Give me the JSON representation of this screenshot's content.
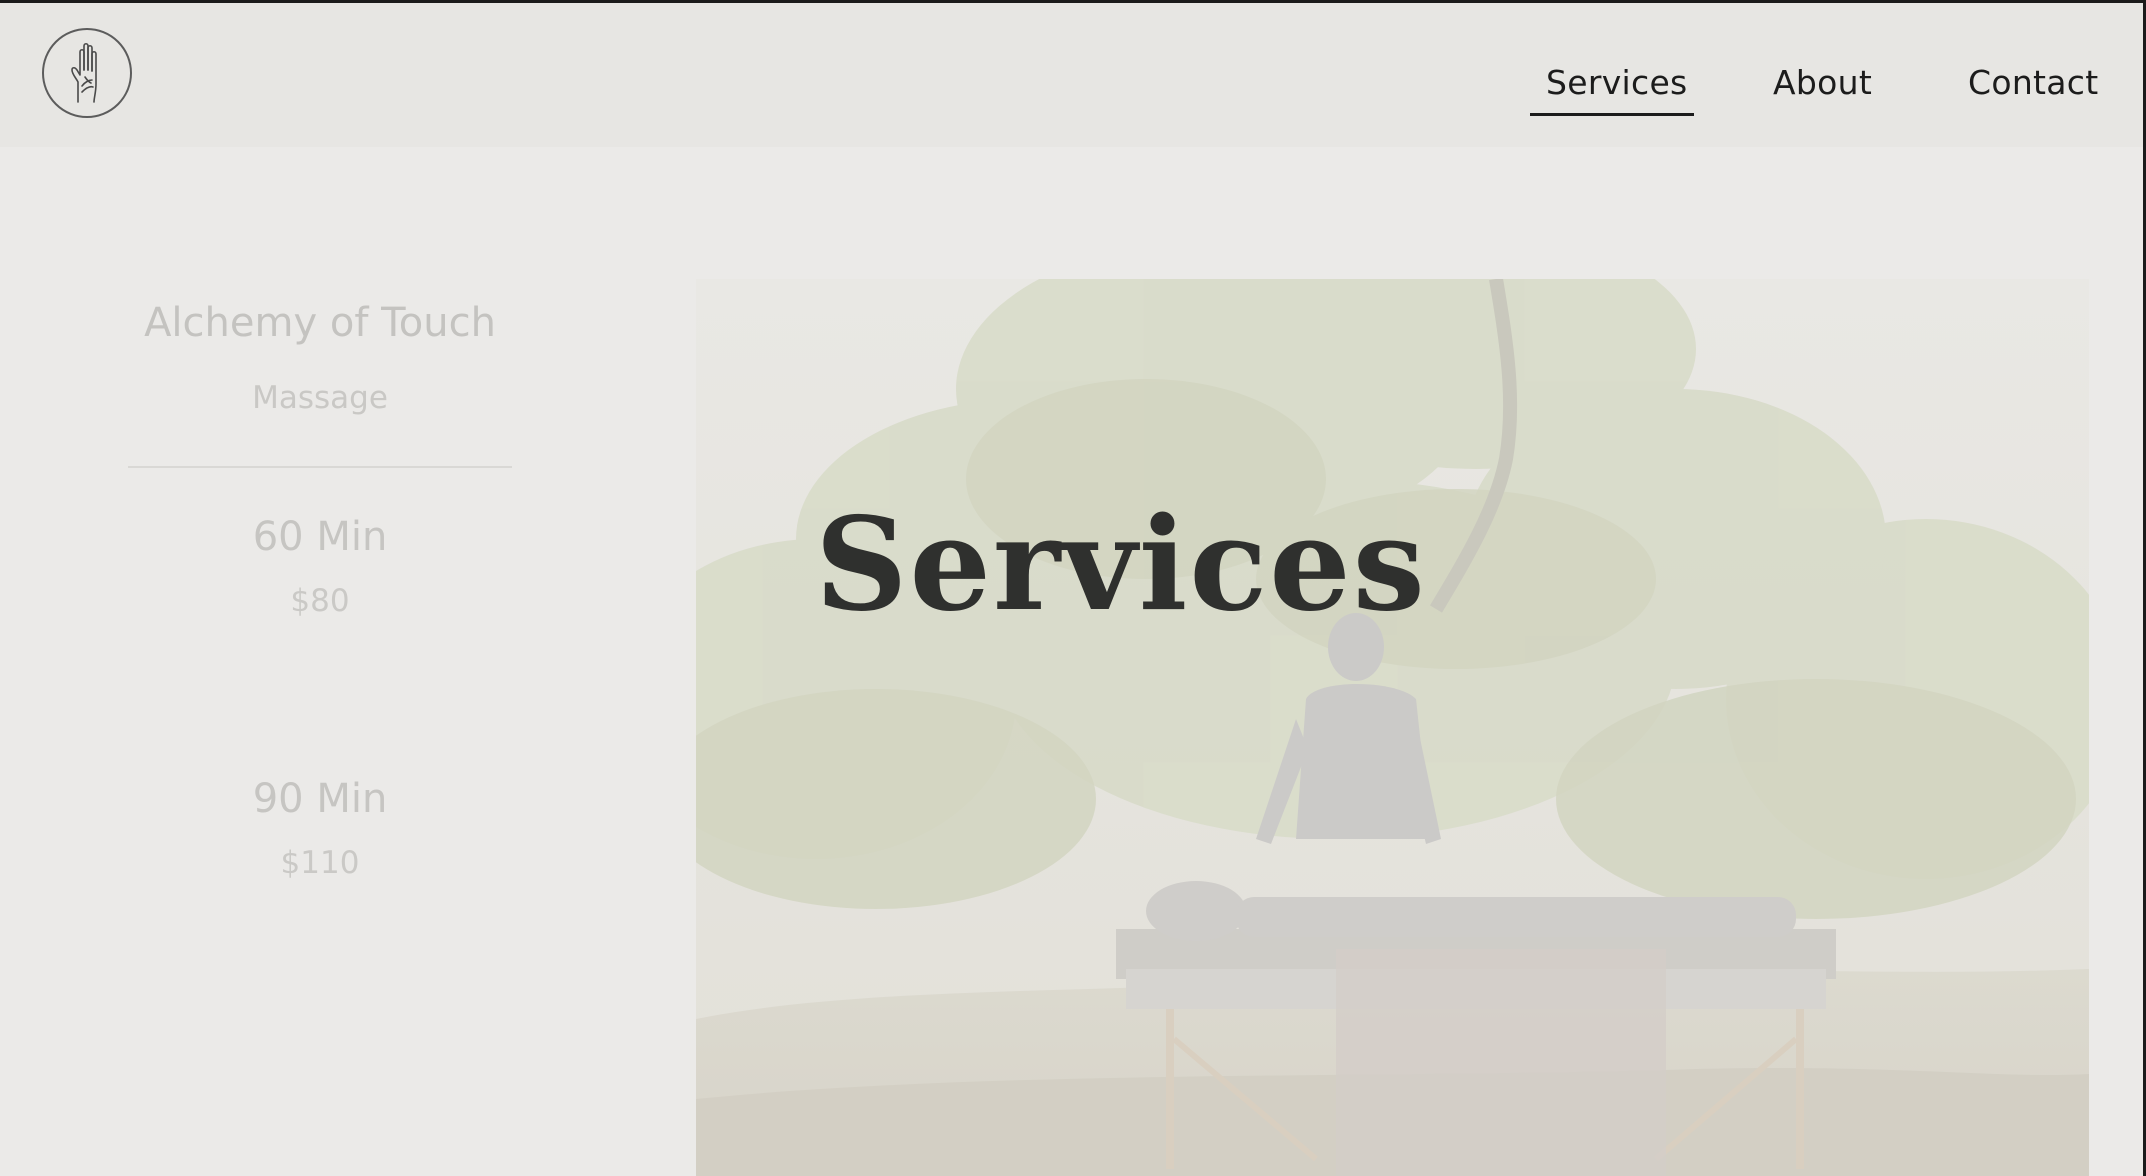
{
  "header": {
    "logo_icon": "raised-hand-icon",
    "nav": [
      {
        "label": "Services",
        "active": true
      },
      {
        "label": "About",
        "active": false
      },
      {
        "label": "Contact",
        "active": false
      }
    ]
  },
  "pricing": {
    "brand": "Alchemy of Touch",
    "service": "Massage",
    "options": [
      {
        "duration": "60 Min",
        "price": "$80"
      },
      {
        "duration": "90 Min",
        "price": "$110"
      }
    ]
  },
  "hero": {
    "title": "Services",
    "image_subject": "outdoor-massage-photo"
  },
  "colors": {
    "background": "#ebeae8",
    "nav_text": "#1c1c1c",
    "hero_title": "#2f302e",
    "faded_text": "#c6c5c2"
  }
}
